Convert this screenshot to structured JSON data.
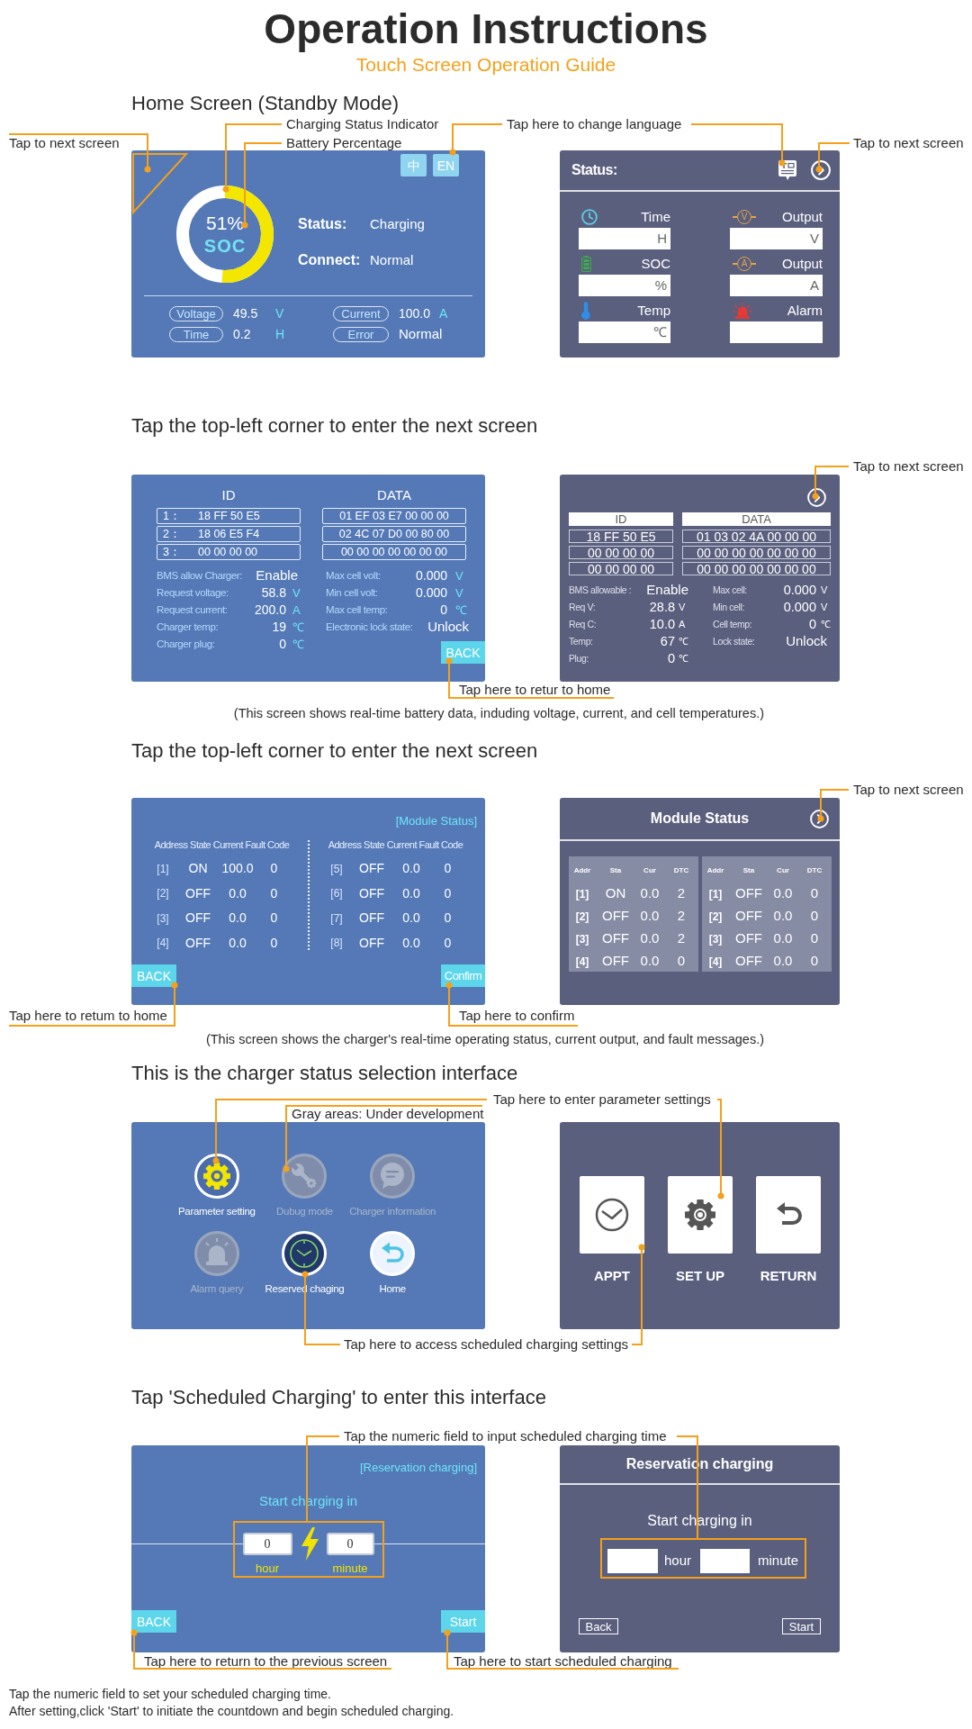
{
  "header": {
    "title": "Operation Instructions",
    "subtitle": "Touch Screen Operation Guide"
  },
  "home_section": {
    "title": "Home Screen (Standby Mode)",
    "callouts": [
      "Tap to next screen",
      "Charging Status Indicator",
      "Battery Percentage",
      "Tap here to change language",
      "Tap to next screen"
    ],
    "left_screen": {
      "language_buttons": [
        "中",
        "EN"
      ],
      "soc": {
        "value": "51%",
        "label": "SOC",
        "level": 0.51
      },
      "status": [
        {
          "label": "Status:",
          "value": "Charging"
        },
        {
          "label": "Connect:",
          "value": "Normal"
        }
      ],
      "readings": [
        {
          "label": "Voltage",
          "value": "49.5",
          "unit": "V"
        },
        {
          "label": "Current",
          "value": "100.0",
          "unit": "A"
        },
        {
          "label": "Time",
          "value": "0.2",
          "unit": "H"
        },
        {
          "label": "Error",
          "value": "Normal"
        }
      ]
    },
    "right_screen": {
      "title": "Status:",
      "fields": [
        {
          "label": "Time",
          "unit": "H"
        },
        {
          "label": "Output",
          "unit": "V",
          "symbol": "V"
        },
        {
          "label": "SOC",
          "unit": "%"
        },
        {
          "label": "Output",
          "unit": "A",
          "symbol": "A"
        },
        {
          "label": "Temp",
          "unit": "℃"
        },
        {
          "label": "Alarm"
        }
      ]
    }
  },
  "bms_section": {
    "title": "Tap the top-left corner to enter the next screen",
    "callouts": [
      "Tap to next screen",
      "Tap here to retur to home"
    ],
    "left_screen": {
      "headers": [
        "ID",
        "DATA"
      ],
      "ids": [
        {
          "index": "1：",
          "value": "18 FF 50 E5"
        },
        {
          "index": "2：",
          "value": "18 06 E5 F4"
        },
        {
          "index": "3：",
          "value": "00 00 00 00"
        }
      ],
      "data": [
        "01 EF 03 E7 00 00 00",
        "02 4C 07 D0 00 80 00",
        "00 00 00 00 00 00 00"
      ],
      "left_values": [
        {
          "label": "BMS allow Charger:",
          "value": "Enable"
        },
        {
          "label": "Request voltage:",
          "value": "58.8",
          "unit": "V"
        },
        {
          "label": "Request current:",
          "value": "200.0",
          "unit": "A"
        },
        {
          "label": "Charger temp:",
          "value": "19",
          "unit": "℃"
        },
        {
          "label": "Charger plug:",
          "value": "0",
          "unit": "℃"
        }
      ],
      "right_values": [
        {
          "label": "Max cell volt:",
          "value": "0.000",
          "unit": "V"
        },
        {
          "label": "Min cell volt:",
          "value": "0.000",
          "unit": "V"
        },
        {
          "label": "Max cell temp:",
          "value": "0",
          "unit": "℃"
        },
        {
          "label": "Electronic lock state:",
          "value": "Unlock"
        }
      ],
      "back_button": "BACK"
    },
    "right_screen": {
      "headers": [
        "ID",
        "DATA"
      ],
      "ids": [
        "18 FF 50 E5",
        "00 00 00 00",
        "00 00 00 00"
      ],
      "data": [
        "01 03 02 4A 00 00 00",
        "00 00 00 00 00 00 00",
        "00 00 00 00 00 00 00"
      ],
      "left_values": [
        {
          "label": "BMS allowable :",
          "value": "Enable"
        },
        {
          "label": "Req V:",
          "value": "28.8",
          "unit": "V"
        },
        {
          "label": "Req C:",
          "value": "10.0",
          "unit": "A"
        },
        {
          "label": "Temp:",
          "value": "67",
          "unit": "℃"
        },
        {
          "label": "Plug:",
          "value": "0",
          "unit": "℃"
        }
      ],
      "right_values": [
        {
          "label": "Max cell:",
          "value": "0.000",
          "unit": "V"
        },
        {
          "label": "Min cell:",
          "value": "0.000",
          "unit": "V"
        },
        {
          "label": "Cell temp:",
          "value": "0",
          "unit": "℃"
        },
        {
          "label": "Lock state:",
          "value": "Unlock"
        }
      ]
    },
    "note": "(This screen shows real-time battery data, induding voltage, current, and cell temperatures.)"
  },
  "module_section": {
    "title": "Tap the top-left corner to enter the next screen",
    "callouts": [
      "Tap to next screen",
      "Tap here to retum to home",
      "Tap here to confirm"
    ],
    "left_screen": {
      "title": "[Module Status]",
      "groups": [
        {
          "header": "Address State Current Fault Code",
          "rows": [
            [
              "[1]",
              "ON",
              "100.0",
              "0"
            ],
            [
              "[2]",
              "OFF",
              "0.0",
              "0"
            ],
            [
              "[3]",
              "OFF",
              "0.0",
              "0"
            ],
            [
              "[4]",
              "OFF",
              "0.0",
              "0"
            ]
          ]
        },
        {
          "header": "Address State Current Fault Code",
          "rows": [
            [
              "[5]",
              "OFF",
              "0.0",
              "0"
            ],
            [
              "[6]",
              "OFF",
              "0.0",
              "0"
            ],
            [
              "[7]",
              "OFF",
              "0.0",
              "0"
            ],
            [
              "[8]",
              "OFF",
              "0.0",
              "0"
            ]
          ]
        }
      ],
      "back_button": "BACK",
      "confirm_button": "Confirm"
    },
    "right_screen": {
      "title": "Module Status",
      "groups": [
        {
          "columns": [
            "Addr",
            "Sta",
            "Cur",
            "DTC"
          ],
          "rows": [
            [
              "[1]",
              "ON",
              "0.0",
              "2"
            ],
            [
              "[2]",
              "OFF",
              "0.0",
              "2"
            ],
            [
              "[3]",
              "OFF",
              "0.0",
              "2"
            ],
            [
              "[4]",
              "OFF",
              "0.0",
              "0"
            ]
          ]
        },
        {
          "columns": [
            "Addr",
            "Sta",
            "Cur",
            "DTC"
          ],
          "rows": [
            [
              "[1]",
              "OFF",
              "0.0",
              "0"
            ],
            [
              "[2]",
              "OFF",
              "0.0",
              "0"
            ],
            [
              "[3]",
              "OFF",
              "0.0",
              "0"
            ],
            [
              "[4]",
              "OFF",
              "0.0",
              "0"
            ]
          ]
        }
      ]
    },
    "note": "(This screen shows the charger's real-time operating status, current output, and fault messages.)"
  },
  "menu_section": {
    "title": "This is the charger status selection interface",
    "callouts": [
      "Tap here to enter parameter settings",
      "Gray areas: Under development",
      "Tap here to access scheduled charging settings"
    ],
    "left_screen": {
      "items": [
        {
          "label": "Parameter setting",
          "disabled": false
        },
        {
          "label": "Dubug mode",
          "disabled": true
        },
        {
          "label": "Charger information",
          "disabled": true
        },
        {
          "label": "Alarm query",
          "disabled": true
        },
        {
          "label": "Reserved chaging",
          "disabled": false
        },
        {
          "label": "Home",
          "disabled": false
        }
      ]
    },
    "right_screen": {
      "buttons": [
        "APPT",
        "SET UP",
        "RETURN"
      ]
    }
  },
  "reservation_section": {
    "title": "Tap 'Scheduled Charging' to enter this interface",
    "callouts": [
      "Tap the numeric field to input scheduled charging time",
      "Tap here to return to the previous screen",
      "Tap here to start scheduled charging"
    ],
    "left_screen": {
      "title": "[Reservation charging]",
      "prompt": "Start charging in",
      "hour": {
        "value": "0",
        "label": "hour"
      },
      "minute": {
        "value": "0",
        "label": "minute"
      },
      "back_button": "BACK",
      "start_button": "Start"
    },
    "right_screen": {
      "title": "Reservation charging",
      "prompt": "Start charging in",
      "hour_label": "hour",
      "minute_label": "minute",
      "back_button": "Back",
      "start_button": "Start"
    }
  },
  "footer_notes": [
    "Tap the numeric field to set your scheduled charging time.",
    "After setting,click 'Start' to initiate the countdown and begin scheduled charging."
  ]
}
